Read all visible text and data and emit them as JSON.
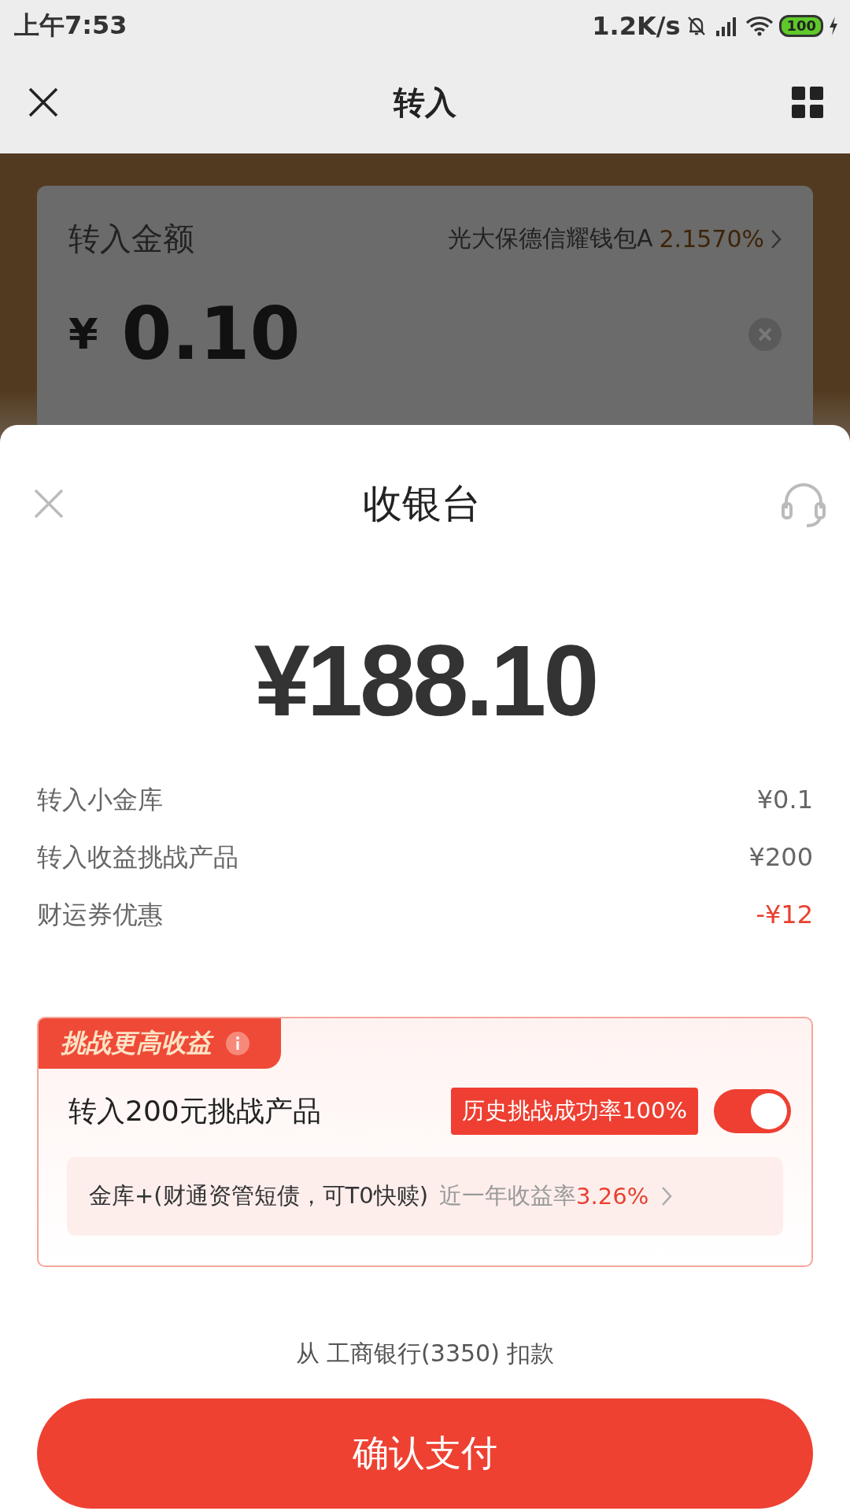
{
  "status_bar": {
    "time": "上午7:53",
    "speed": "1.2K/s",
    "battery": "100"
  },
  "nav": {
    "title": "转入"
  },
  "transfer_card": {
    "label": "转入金额",
    "product": "光大保德信耀钱包A",
    "rate": "2.1570%",
    "currency": "¥",
    "amount": "0.10"
  },
  "sheet": {
    "title": "收银台",
    "total": "¥188.10",
    "items": [
      {
        "label": "转入小金库",
        "value": "¥0.1",
        "kind": "normal"
      },
      {
        "label": "转入收益挑战产品",
        "value": "¥200",
        "kind": "normal"
      },
      {
        "label": "财运券优惠",
        "value": "-¥12",
        "kind": "discount"
      }
    ],
    "challenge": {
      "tag": "挑战更高收益",
      "label": "转入200元挑战产品",
      "tooltip": "历史挑战成功率100%",
      "on": true,
      "product": "金库+(财通资管短债，可T0快赎)",
      "rate_label": "近一年收益率",
      "rate": "3.26%"
    },
    "payment_source": "从 工商银行(3350) 扣款",
    "confirm": "确认支付"
  }
}
